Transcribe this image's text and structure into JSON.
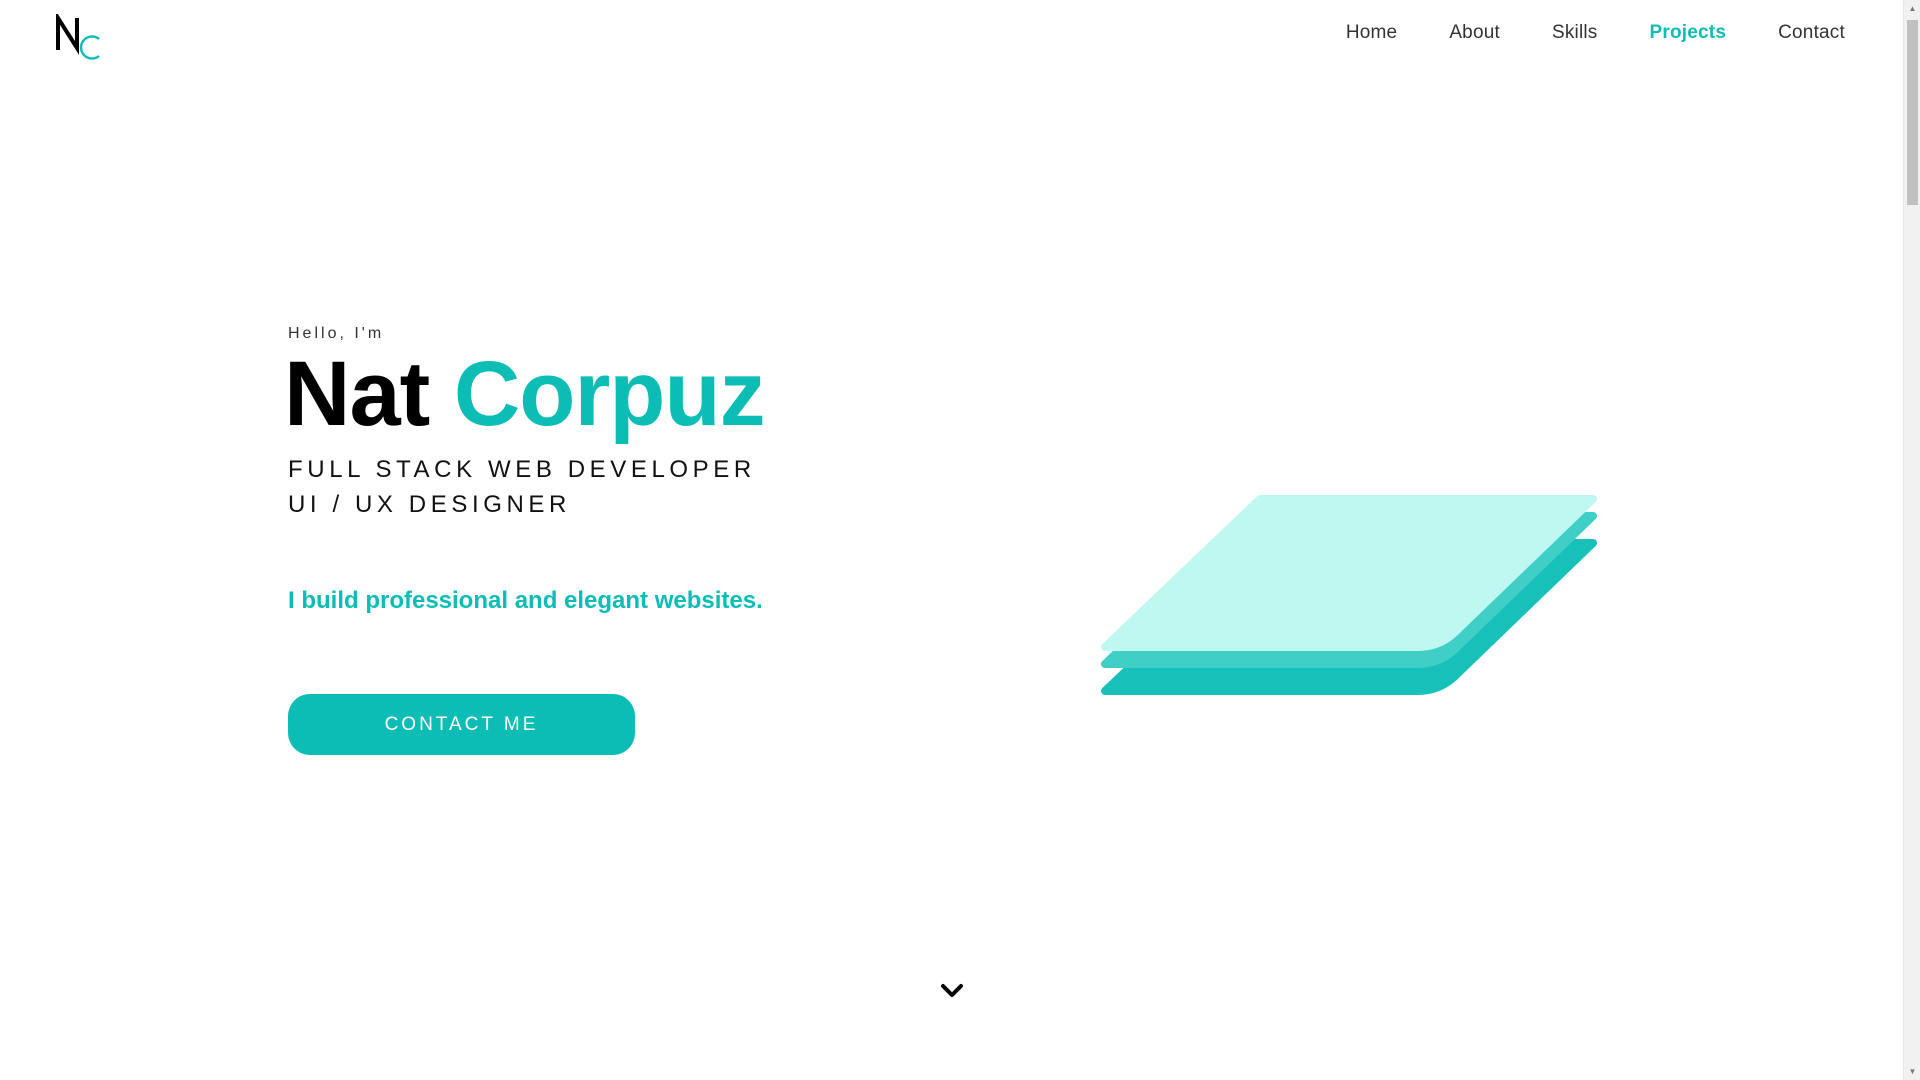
{
  "logo": {
    "letter": "N",
    "icon": "nc-monogram-logo"
  },
  "nav": {
    "items": [
      {
        "label": "Home",
        "active": false
      },
      {
        "label": "About",
        "active": false
      },
      {
        "label": "Skills",
        "active": false
      },
      {
        "label": "Projects",
        "active": true
      },
      {
        "label": "Contact",
        "active": false
      }
    ]
  },
  "hero": {
    "greeting": "Hello, I'm",
    "first_name": "Nat",
    "last_name": "Corpuz",
    "role_line_1": "FULL STACK WEB DEVELOPER",
    "role_line_2": "UI / UX DESIGNER",
    "tagline": "I build professional and elegant websites.",
    "cta_label": "CONTACT ME"
  },
  "illustration": {
    "icon": "stacked-layers-icon"
  },
  "scroll": {
    "icon": "chevron-down-icon"
  },
  "colors": {
    "accent": "#0bbdb5",
    "layer_light": "#bff8f0",
    "layer_mid": "#3fcfc6",
    "layer_dark": "#17c1b9",
    "text": "#111111"
  }
}
